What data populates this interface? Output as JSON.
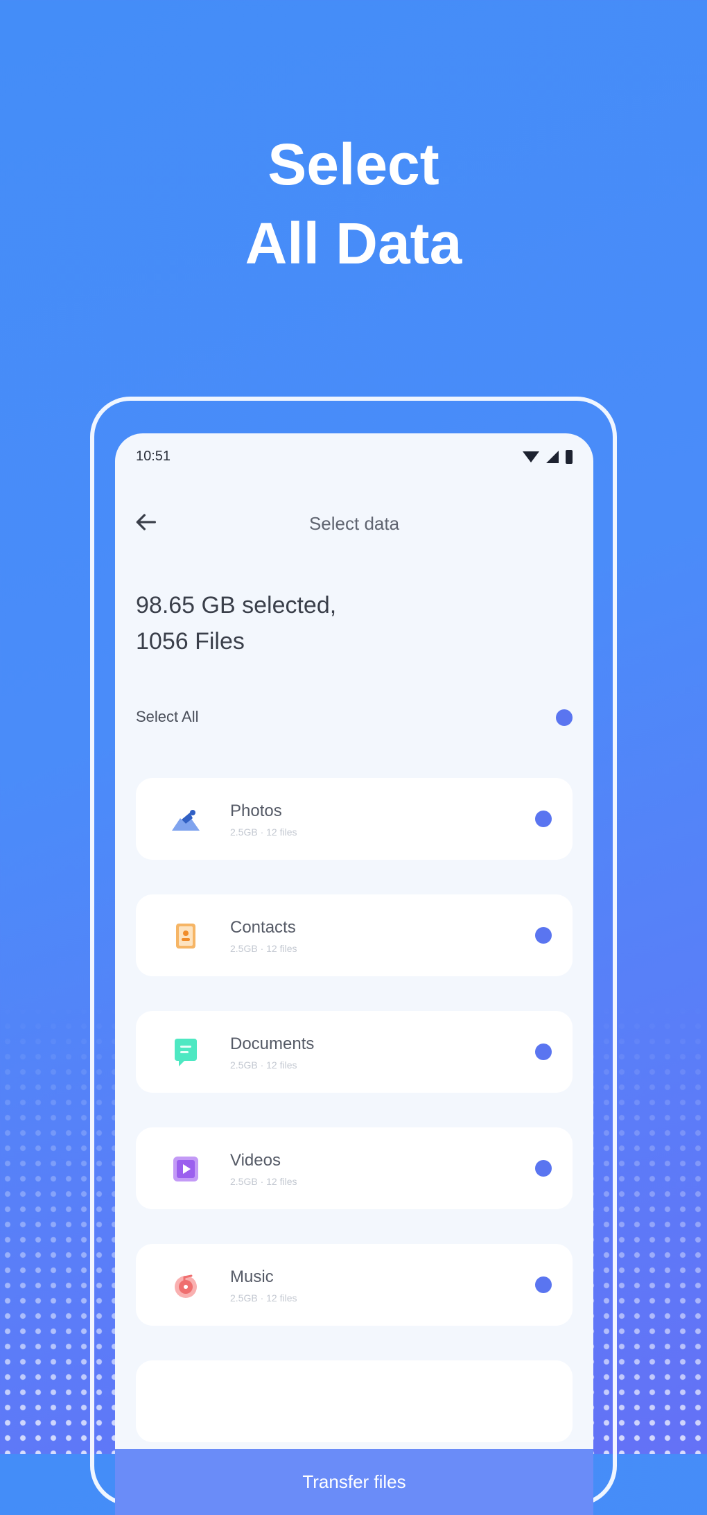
{
  "hero": {
    "title_line1": "Select",
    "title_line2": "All Data"
  },
  "status_bar": {
    "time": "10:51"
  },
  "screen": {
    "title": "Select data",
    "summary_line1": "98.65 GB selected,",
    "summary_line2": "1056 Files",
    "select_all_label": "Select All"
  },
  "categories": [
    {
      "label": "Photos",
      "sub": "2.5GB · 12 files",
      "icon": "photos-icon",
      "color": "#4a7ad8"
    },
    {
      "label": "Contacts",
      "sub": "2.5GB · 12 files",
      "icon": "contacts-icon",
      "color": "#f2a34d"
    },
    {
      "label": "Documents",
      "sub": "2.5GB · 12 files",
      "icon": "documents-icon",
      "color": "#3ee0b8"
    },
    {
      "label": "Videos",
      "sub": "2.5GB · 12 files",
      "icon": "videos-icon",
      "color": "#a46ff0"
    },
    {
      "label": "Music",
      "sub": "2.5GB · 12 files",
      "icon": "music-icon",
      "color": "#ef6f6f"
    }
  ],
  "footer": {
    "button_label": "Transfer files"
  },
  "colors": {
    "accent": "#5a75f0",
    "background": "#448df8",
    "screen_bg": "#f3f7fd"
  }
}
